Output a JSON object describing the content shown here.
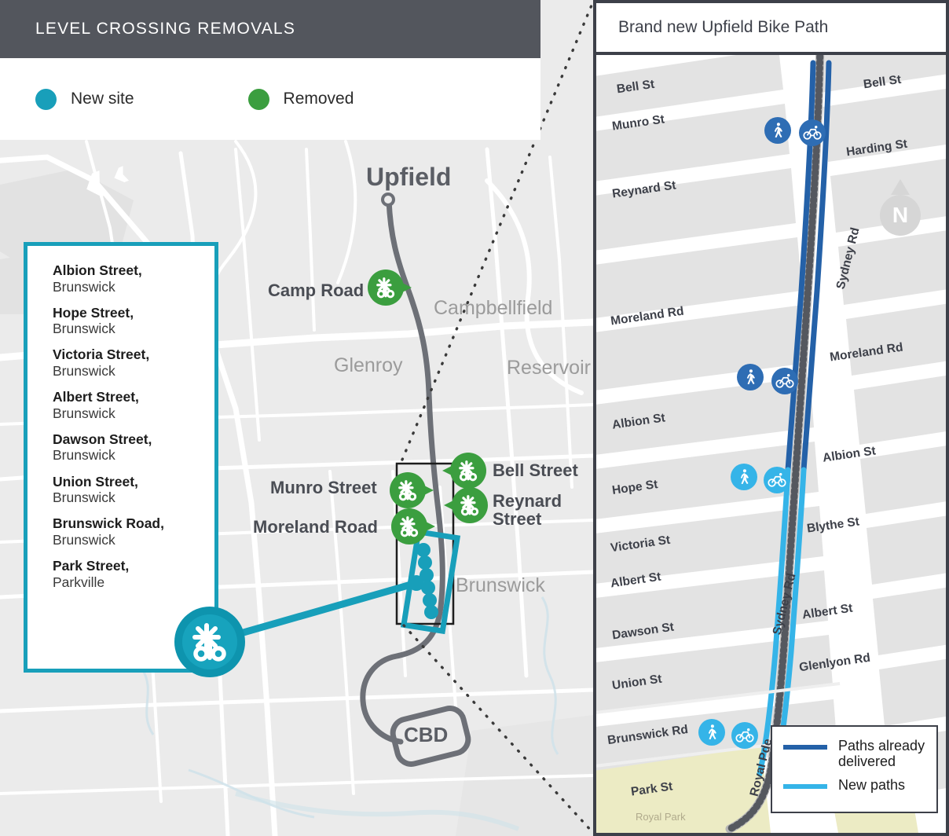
{
  "header": {
    "title": "LEVEL CROSSING REMOVALS"
  },
  "legend": {
    "items": [
      {
        "label": "New site",
        "color": "#189fba",
        "icon": "filled-circle"
      },
      {
        "label": "Removed",
        "color": "#3b9e3f",
        "icon": "filled-circle"
      }
    ]
  },
  "street_panel": {
    "border_color": "#189fba",
    "items": [
      {
        "name": "Albion Street,",
        "suburb": "Brunswick"
      },
      {
        "name": "Hope Street,",
        "suburb": "Brunswick"
      },
      {
        "name": "Victoria Street,",
        "suburb": "Brunswick"
      },
      {
        "name": "Albert Street,",
        "suburb": "Brunswick"
      },
      {
        "name": "Dawson Street,",
        "suburb": "Brunswick"
      },
      {
        "name": "Union Street,",
        "suburb": "Brunswick"
      },
      {
        "name": "Brunswick Road,",
        "suburb": "Brunswick"
      },
      {
        "name": "Park Street,",
        "suburb": "Parkville"
      }
    ]
  },
  "overview_map": {
    "line_terminus_label": "Upfield",
    "cbd_label": "CBD",
    "place_labels": [
      {
        "text": "Campbellfield"
      },
      {
        "text": "Glenroy"
      },
      {
        "text": "Reservoir"
      },
      {
        "text": "Brunswick"
      }
    ],
    "crossing_labels": [
      {
        "text": "Camp Road"
      },
      {
        "text": "Munro Street"
      },
      {
        "text": "Moreland Road"
      },
      {
        "text": "Bell Street"
      },
      {
        "text": "Reynard",
        "text2": "Street"
      }
    ],
    "badge_icon": "level-crossing-icon",
    "badge_color": "#0e94ae"
  },
  "inset": {
    "title": "Brand new Upfield Bike Path",
    "compass_label": "N",
    "legend": {
      "items": [
        {
          "label": "Paths already delivered",
          "line1": "Paths already",
          "line2": "delivered",
          "color": "#2461a8"
        },
        {
          "label": "New paths",
          "line1": "New paths",
          "line2": "",
          "color": "#35b4e8"
        }
      ]
    },
    "street_labels_left": [
      {
        "text": "Bell St"
      },
      {
        "text": "Munro St"
      },
      {
        "text": "Reynard St"
      },
      {
        "text": "Moreland Rd"
      },
      {
        "text": "Albion St"
      },
      {
        "text": "Hope St"
      },
      {
        "text": "Victoria St"
      },
      {
        "text": "Albert St"
      },
      {
        "text": "Dawson St"
      },
      {
        "text": "Union St"
      },
      {
        "text": "Brunswick Rd"
      },
      {
        "text": "Park St"
      }
    ],
    "street_labels_right": [
      {
        "text": "Bell St"
      },
      {
        "text": "Harding St"
      },
      {
        "text": "Moreland Rd"
      },
      {
        "text": "Albion St"
      },
      {
        "text": "Blythe St"
      },
      {
        "text": "Albert St"
      },
      {
        "text": "Glenlyon Rd"
      },
      {
        "text": "Sydney Rd"
      },
      {
        "text": "Sydney Rd"
      },
      {
        "text": "Royal Pde"
      }
    ],
    "park_label": "Royal Park",
    "mode_icons": [
      {
        "type": "pedestrian-icon",
        "state": "dark"
      },
      {
        "type": "bicycle-icon",
        "state": "dark"
      },
      {
        "type": "pedestrian-icon",
        "state": "dark"
      },
      {
        "type": "bicycle-icon",
        "state": "dark"
      },
      {
        "type": "pedestrian-icon",
        "state": "light"
      },
      {
        "type": "bicycle-icon",
        "state": "light"
      },
      {
        "type": "pedestrian-icon",
        "state": "light"
      },
      {
        "type": "bicycle-icon",
        "state": "light"
      }
    ]
  }
}
